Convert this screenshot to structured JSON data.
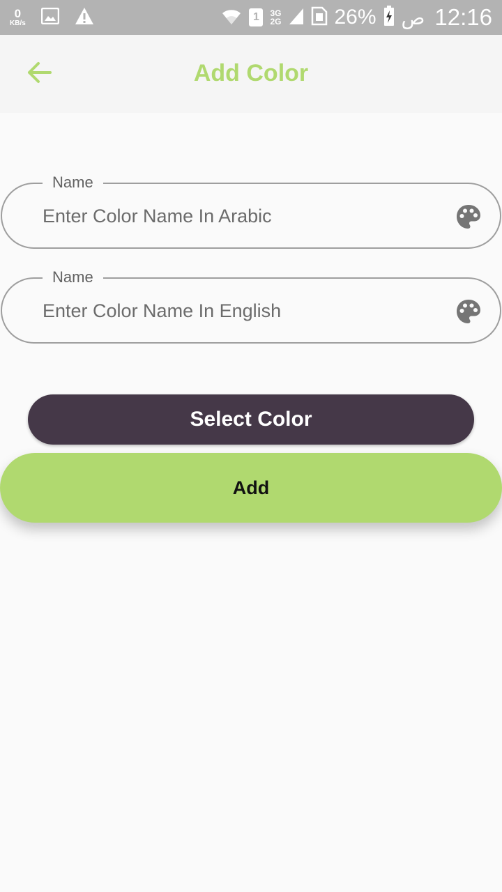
{
  "status_bar": {
    "speed_value": "0",
    "speed_unit": "KB/s",
    "network_types": [
      "3G",
      "2G"
    ],
    "sim_slot": "1",
    "battery_percent": "26%",
    "ampm": "ص",
    "time": "12:16"
  },
  "app_bar": {
    "title": "Add Color",
    "accent_color": "#b0d96f"
  },
  "form": {
    "fields": [
      {
        "label": "Name",
        "placeholder": "Enter Color Name In Arabic",
        "value": "",
        "icon": "palette-icon"
      },
      {
        "label": "Name",
        "placeholder": "Enter Color Name In English",
        "value": "",
        "icon": "palette-icon"
      }
    ]
  },
  "buttons": {
    "select_color": "Select Color",
    "select_color_bg": "#453848",
    "add": "Add",
    "add_bg": "#b0d96f"
  }
}
